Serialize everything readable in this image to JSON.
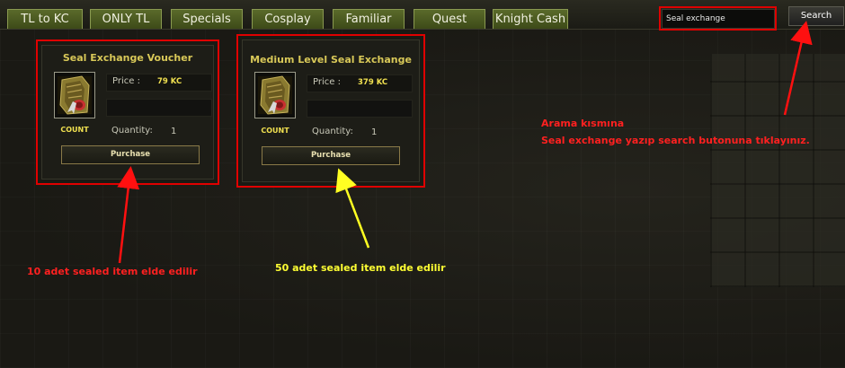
{
  "tabs": [
    {
      "label": "TL to KC"
    },
    {
      "label": "ONLY TL"
    },
    {
      "label": "Specials"
    },
    {
      "label": "Cosplay"
    },
    {
      "label": "Familiar"
    },
    {
      "label": "Quest"
    },
    {
      "label": "Knight Cash"
    }
  ],
  "search": {
    "value": "Seal exchange",
    "button_label": "Search"
  },
  "items": [
    {
      "title": "Seal Exchange Voucher",
      "price_label": "Price :",
      "price_value": "79 KC",
      "count_label": "COUNT",
      "quantity_label": "Quantity:",
      "quantity_value": "1",
      "purchase_label": "Purchase",
      "icon": "seal-scroll-icon"
    },
    {
      "title": "Medium Level Seal Exchange",
      "price_label": "Price :",
      "price_value": "379 KC",
      "count_label": "COUNT",
      "quantity_label": "Quantity:",
      "quantity_value": "1",
      "purchase_label": "Purchase",
      "icon": "seal-scroll-icon"
    }
  ],
  "annotations": {
    "instruction_line1": "Arama kısmına",
    "instruction_line2": "Seal exchange yazıp search butonuna tıklayınız.",
    "note_item1": "10 adet sealed item elde edilir",
    "note_item2": "50 adet sealed item elde edilir"
  },
  "colors": {
    "highlight_red": "#e00000",
    "arrow_yellow": "#ffff22",
    "annotation_red": "#ff2020",
    "annotation_yellow": "#ffff33",
    "tab_green": "#4e5c22",
    "price_yellow": "#f0e050"
  }
}
